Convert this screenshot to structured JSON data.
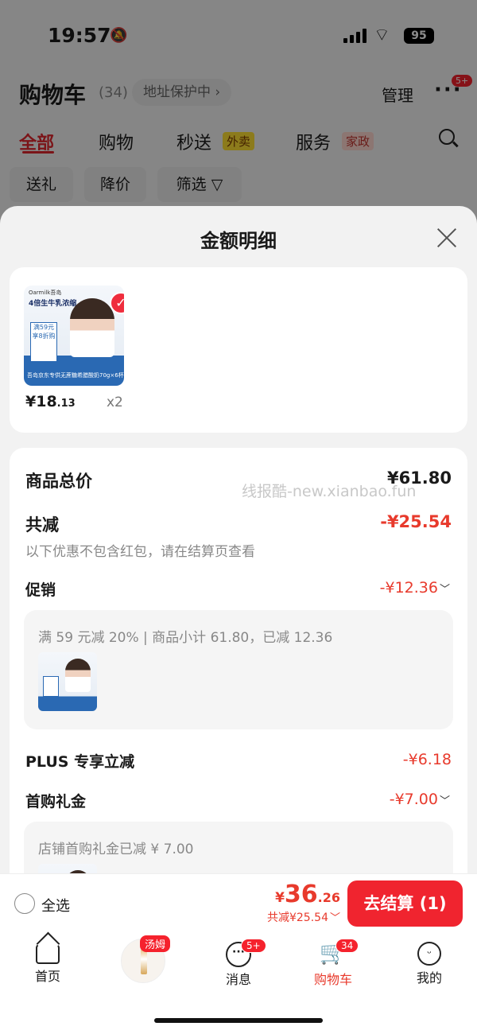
{
  "status_bar": {
    "time": "19:57",
    "battery": "95"
  },
  "cart": {
    "title": "购物车",
    "count": "(34)",
    "address_pill": "地址保护中 ›",
    "manage": "管理",
    "more_badge": "5+",
    "tabs": [
      "全部",
      "购物",
      "秒送",
      "服务"
    ],
    "tab_tags": [
      "外卖",
      "家政"
    ],
    "chips": [
      "送礼",
      "降价",
      "筛选 ▽"
    ]
  },
  "sheet": {
    "title": "金额明细",
    "product": {
      "price_main": "¥18",
      "price_dec": ".13",
      "qty": "x2",
      "image_brand": "Oarmilk吾岛",
      "image_headline": "4倍生牛乳浓缩",
      "image_caption": "吾岛京东专供无蔗糖希腊酸奶70g×6杯",
      "image_panel": "满59元 享8折购"
    },
    "summary": {
      "goods_total_label": "商品总价",
      "goods_total_value": "¥61.80",
      "watermark": "线报酷-new.xianbao.fun",
      "reduce_label": "共减",
      "reduce_value": "-¥25.54",
      "reduce_note": "以下优惠不包含红包，请在结算页查看",
      "promo_label": "促销",
      "promo_value": "-¥12.36",
      "promo_detail": "满 59 元减 20% | 商品小计 61.80，已减 12.36",
      "plus_label": "PLUS 专享立减",
      "plus_value": "-¥6.18",
      "gift_label": "首购礼金",
      "gift_value": "-¥7.00",
      "gift_detail": "店铺首购礼金已减 ¥ 7.00"
    }
  },
  "checkout": {
    "select_all": "全选",
    "yen": "¥",
    "total_int": "36",
    "total_dec": ".26",
    "discount": "共减¥25.54",
    "pay_button": "去结算 (1)"
  },
  "tabbar": {
    "items": [
      "首页",
      "消息",
      "购物车",
      "我的"
    ],
    "mid_tag": "汤姆",
    "msg_badge": "5+",
    "cart_badge": "34"
  },
  "colors": {
    "accent": "#e83a2c",
    "button": "#f0242f"
  }
}
